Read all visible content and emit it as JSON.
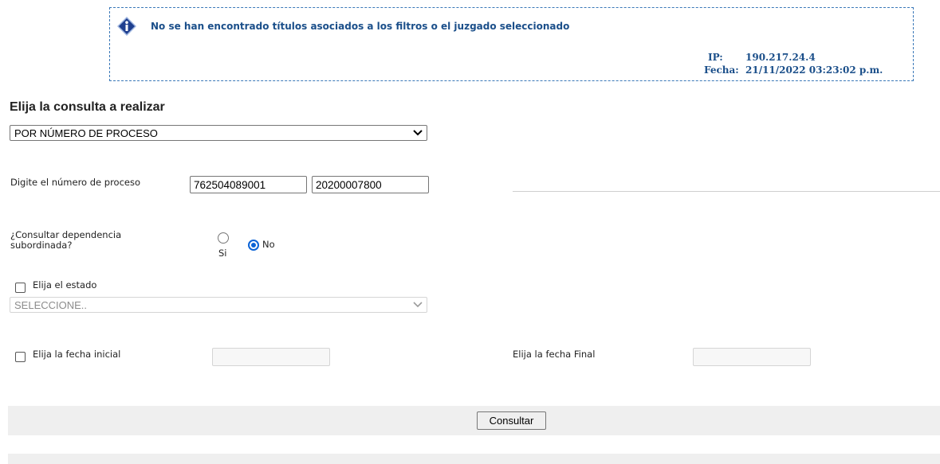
{
  "notice": {
    "message": "No se han encontrado títulos asociados a los filtros o el juzgado seleccionado",
    "ip_label": "IP:",
    "ip_value": "190.217.24.4",
    "fecha_label": "Fecha:",
    "fecha_value": "21/11/2022 03:23:02 p.m."
  },
  "query": {
    "title": "Elija la consulta a realizar",
    "type_selected": "POR NÚMERO DE PROCESO"
  },
  "process": {
    "label": "Digite el número de proceso",
    "part1": "762504089001",
    "part2": "20200007800"
  },
  "subordinate": {
    "label_line1": "¿Consultar dependencia",
    "label_line2": "subordinada?",
    "option_si": "Si",
    "option_no": "No",
    "selected": "No"
  },
  "estado": {
    "label": "Elija el estado",
    "checked": false,
    "selected": "SELECCIONE.."
  },
  "dates": {
    "initial_label": "Elija la fecha inicial",
    "initial_checked": false,
    "initial_value": "",
    "final_label": "Elija la fecha Final",
    "final_value": ""
  },
  "actions": {
    "submit_label": "Consultar"
  },
  "colors": {
    "notice_text": "#1b4f8a",
    "notice_border": "#3a78b8",
    "radio_selected": "#0b63d6",
    "bar": "#efefef"
  }
}
